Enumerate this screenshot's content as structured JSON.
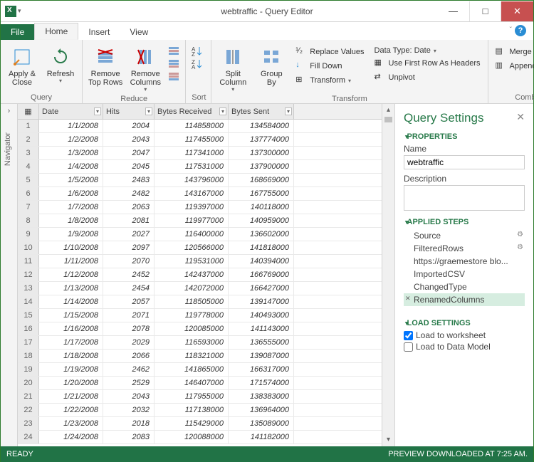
{
  "title": "webtraffic - Query Editor",
  "tabs": {
    "file": "File",
    "home": "Home",
    "insert": "Insert",
    "view": "View"
  },
  "ribbon": {
    "query": {
      "label": "Query",
      "apply_close": "Apply &\nClose",
      "refresh": "Refresh"
    },
    "reduce": {
      "label": "Reduce",
      "remove_top": "Remove\nTop Rows",
      "remove_cols": "Remove\nColumns"
    },
    "sort": {
      "label": "Sort"
    },
    "transform": {
      "label": "Transform",
      "split": "Split\nColumn",
      "group": "Group\nBy",
      "replace": "Replace Values",
      "fill": "Fill Down",
      "transformbtn": "Transform",
      "datatype": "Data Type: Date",
      "firstrow": "Use First Row As Headers",
      "unpivot": "Unpivot"
    },
    "combine": {
      "label": "Combine",
      "merge": "Merge Queries",
      "append": "Append Queries"
    }
  },
  "nav": "Navigator",
  "columns": [
    "Date",
    "Hits",
    "Bytes Received",
    "Bytes Sent"
  ],
  "rows": [
    [
      "1/1/2008",
      "2004",
      "114858000",
      "134584000"
    ],
    [
      "1/2/2008",
      "2043",
      "117455000",
      "137774000"
    ],
    [
      "1/3/2008",
      "2047",
      "117341000",
      "137300000"
    ],
    [
      "1/4/2008",
      "2045",
      "117531000",
      "137900000"
    ],
    [
      "1/5/2008",
      "2483",
      "143796000",
      "168669000"
    ],
    [
      "1/6/2008",
      "2482",
      "143167000",
      "167755000"
    ],
    [
      "1/7/2008",
      "2063",
      "119397000",
      "140118000"
    ],
    [
      "1/8/2008",
      "2081",
      "119977000",
      "140959000"
    ],
    [
      "1/9/2008",
      "2027",
      "116400000",
      "136602000"
    ],
    [
      "1/10/2008",
      "2097",
      "120566000",
      "141818000"
    ],
    [
      "1/11/2008",
      "2070",
      "119531000",
      "140394000"
    ],
    [
      "1/12/2008",
      "2452",
      "142437000",
      "166769000"
    ],
    [
      "1/13/2008",
      "2454",
      "142072000",
      "166427000"
    ],
    [
      "1/14/2008",
      "2057",
      "118505000",
      "139147000"
    ],
    [
      "1/15/2008",
      "2071",
      "119778000",
      "140493000"
    ],
    [
      "1/16/2008",
      "2078",
      "120085000",
      "141143000"
    ],
    [
      "1/17/2008",
      "2029",
      "116593000",
      "136555000"
    ],
    [
      "1/18/2008",
      "2066",
      "118321000",
      "139087000"
    ],
    [
      "1/19/2008",
      "2462",
      "141865000",
      "166317000"
    ],
    [
      "1/20/2008",
      "2529",
      "146407000",
      "171574000"
    ],
    [
      "1/21/2008",
      "2043",
      "117955000",
      "138383000"
    ],
    [
      "1/22/2008",
      "2032",
      "117138000",
      "136964000"
    ],
    [
      "1/23/2008",
      "2018",
      "115429000",
      "135089000"
    ],
    [
      "1/24/2008",
      "2083",
      "120088000",
      "141182000"
    ]
  ],
  "pane": {
    "title": "Query Settings",
    "properties": "PROPERTIES",
    "name_label": "Name",
    "name_value": "webtraffic",
    "desc_label": "Description",
    "applied": "APPLIED STEPS",
    "steps": [
      "Source",
      "FilteredRows",
      "https://graemestore blo...",
      "ImportedCSV",
      "ChangedType",
      "RenamedColumns"
    ],
    "load": "LOAD SETTINGS",
    "load_ws": "Load to worksheet",
    "load_dm": "Load to Data Model"
  },
  "status": {
    "ready": "READY",
    "preview": "PREVIEW DOWNLOADED AT 7:25 AM."
  }
}
